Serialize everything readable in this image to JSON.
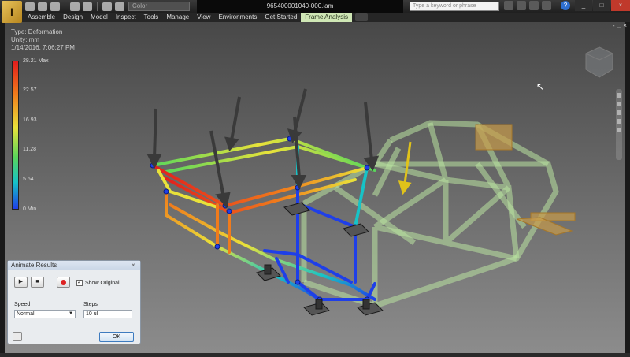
{
  "app": {
    "logo_label": "I",
    "document_title": "965400001040-000.iam"
  },
  "quick_access": {
    "color_combo": "Color"
  },
  "search": {
    "placeholder": "Type a keyword or phrase"
  },
  "help_label": "?",
  "window_controls": [
    "_",
    "□",
    "×"
  ],
  "ribbon": {
    "tabs": [
      {
        "label": "Assemble",
        "active": false
      },
      {
        "label": "Design",
        "active": false
      },
      {
        "label": "Model",
        "active": false
      },
      {
        "label": "Inspect",
        "active": false
      },
      {
        "label": "Tools",
        "active": false
      },
      {
        "label": "Manage",
        "active": false
      },
      {
        "label": "View",
        "active": false
      },
      {
        "label": "Environments",
        "active": false
      },
      {
        "label": "Get Started",
        "active": false
      },
      {
        "label": "Frame Analysis",
        "active": true
      }
    ]
  },
  "document_controls": [
    "-",
    "□",
    "×"
  ],
  "results_info": {
    "type": "Type: Deformation",
    "unity": "Unity: mm",
    "date": "1/14/2016, 7:06:27 PM"
  },
  "legend": {
    "labels": [
      "28.21 Max",
      "22.57",
      "16.93",
      "11.28",
      "5.64",
      "0 Min"
    ],
    "colors": [
      "#e21d1d",
      "#f07b1b",
      "#e9e23a",
      "#59d65b",
      "#16c3c7",
      "#1f3fe8"
    ]
  },
  "animate_dialog": {
    "title": "Animate Results",
    "play_icon": "play-icon",
    "stop_icon": "stop-icon",
    "record_icon": "record-icon",
    "show_original_label": "Show Original",
    "show_original_checked": true,
    "speed_label": "Speed",
    "speed_value": "Normal",
    "steps_label": "Steps",
    "steps_value": "10 ul",
    "ok_label": "OK"
  }
}
